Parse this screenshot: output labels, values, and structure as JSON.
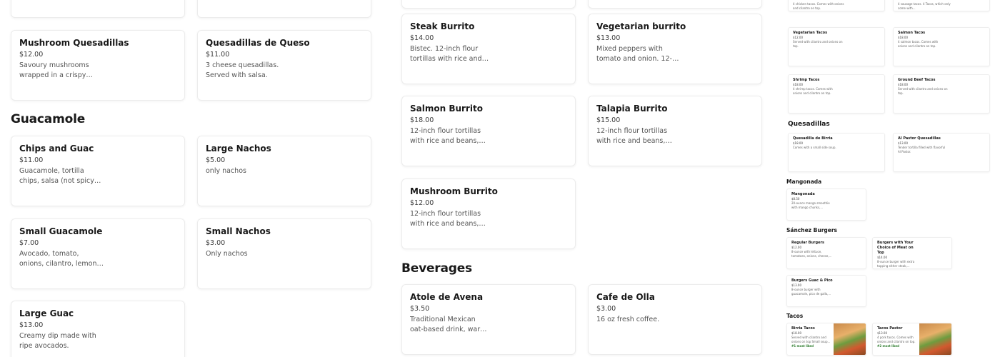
{
  "left": {
    "items_top": [
      {
        "name": "Mushroom Quesadillas",
        "price": "$12.00",
        "desc": "Savoury mushrooms wrapped in a crispy tortilla."
      },
      {
        "name": "Quesadillas de Queso",
        "price": "$11.00",
        "desc": "3 cheese quesadillas. Served with salsa."
      }
    ],
    "guac_title": "Guacamole",
    "guac_items": [
      {
        "name": "Chips and Guac",
        "price": "$11.00",
        "desc": "Guacamole, tortilla chips, salsa (not spicy), pico de..."
      },
      {
        "name": "Large Nachos",
        "price": "$5.00",
        "desc": "only nachos"
      },
      {
        "name": "Small Guacamole",
        "price": "$7.00",
        "desc": "Avocado, tomato, onions, cilantro, lemon, and salt."
      },
      {
        "name": "Small Nachos",
        "price": "$3.00",
        "desc": "Only nachos"
      },
      {
        "name": "Large Guac",
        "price": "$13.00",
        "desc": "Creamy dip made with ripe avocados."
      }
    ]
  },
  "middle": {
    "burritos": [
      {
        "name": "Steak Burrito",
        "price": "$14.00",
        "desc": "Bistec. 12-inch flour tortillas with rice and beans, chees..."
      },
      {
        "name": "Vegetarian burrito",
        "price": "$13.00",
        "desc": "Mixed peppers with tomato and onion. 12-inch flour..."
      },
      {
        "name": "Salmon Burrito",
        "price": "$18.00",
        "desc": "12-inch flour tortillas with rice and beans, cheese,..."
      },
      {
        "name": "Talapia Burrito",
        "price": "$15.00",
        "desc": "12-inch flour tortillas with rice and beans, cheese,..."
      },
      {
        "name": "Mushroom Burrito",
        "price": "$12.00",
        "desc": "12-inch flour tortillas with rice and beans, cheese,..."
      }
    ],
    "bev_title": "Beverages",
    "beverages": [
      {
        "name": "Atole de Avena",
        "price": "$3.50",
        "desc": "Traditional Mexican oat-based drink, warm and..."
      },
      {
        "name": "Cafe de Olla",
        "price": "$3.00",
        "desc": "16 oz fresh coffee."
      }
    ]
  },
  "preview": {
    "top_items": [
      {
        "desc": "4 chicken tacos. Comes with onions and cilantro on top."
      },
      {
        "desc": "4 sausage tacos. 4 Tacos, which only come with..."
      }
    ],
    "tacos_grid": [
      {
        "name": "Vegetarian Tacos",
        "price": "$12.00",
        "desc": "Served with cilantro and onions on top."
      },
      {
        "name": "Salmon Tacos",
        "price": "$18.00",
        "desc": "4 salmon tacos. Comes with onions and cilantro on top."
      },
      {
        "name": "Shrimp Tacos",
        "price": "$18.00",
        "desc": "4 shrimp tacos. Comes with onions and cilantro on top."
      },
      {
        "name": "Ground Beef Tacos",
        "price": "$18.00",
        "desc": "Served with cilantro and onions on top."
      }
    ],
    "quesadillas_title": "Quesadillas",
    "quesadillas": [
      {
        "name": "Quesadilla de Birria",
        "price": "$18.00",
        "desc": "Comes with a small side soup."
      },
      {
        "name": "Al Pastor Quesadillas",
        "price": "$13.00",
        "desc": "Tender tortilla filled with flavorful Al Pastor."
      }
    ],
    "mangonada_title": "Mangonada",
    "mangonada": {
      "name": "Mangonada",
      "price": "$8.50",
      "desc": "20-ounce mango smoothie with mango chunks,..."
    },
    "burgers_title": "Sánchez Burgers",
    "burgers": [
      {
        "name": "Regular Burgers",
        "price": "$12.00",
        "desc": "8-ounce with lettuce, tomatoes, onions, cheese,..."
      },
      {
        "name": "Burgers with Your Choice of Meat on Top",
        "price": "$14.00",
        "desc": "8-ounce burger with extra topping either steak,..."
      },
      {
        "name": "Burgers Guac & Pico",
        "price": "$13.00",
        "desc": "8-ounce burger with guacamole, pico de gallo,..."
      }
    ],
    "tacos_title": "Tacos",
    "tacos": [
      {
        "name": "Birria Tacos",
        "price": "$18.00",
        "desc": "Served with cilantro and onions on top Small soup...",
        "badge": "#1 most liked"
      },
      {
        "name": "Tacos Pastor",
        "price": "$13.00",
        "desc": "4 pork tacos. Comes with onions and cilantro on top.",
        "badge": "#2 most liked"
      }
    ]
  }
}
